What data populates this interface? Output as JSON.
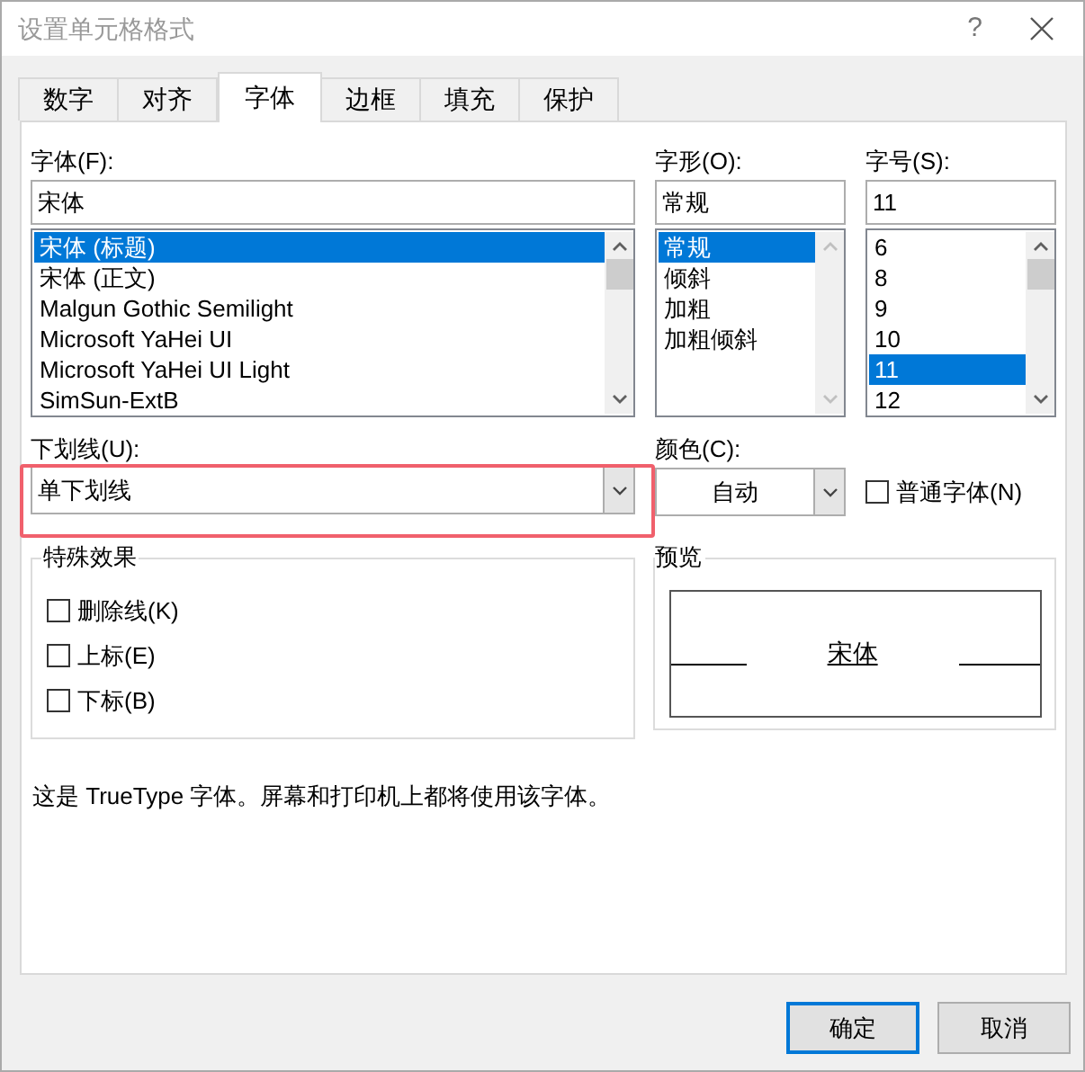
{
  "window": {
    "title": "设置单元格格式",
    "help": "?"
  },
  "tabs": [
    {
      "label": "数字",
      "selected": false
    },
    {
      "label": "对齐",
      "selected": false
    },
    {
      "label": "字体",
      "selected": true
    },
    {
      "label": "边框",
      "selected": false
    },
    {
      "label": "填充",
      "selected": false
    },
    {
      "label": "保护",
      "selected": false
    }
  ],
  "font": {
    "label": "字体(F):",
    "value": "宋体",
    "items": [
      {
        "text": "宋体 (标题)",
        "selected": true
      },
      {
        "text": "宋体 (正文)",
        "selected": false
      },
      {
        "text": "Malgun Gothic Semilight",
        "selected": false
      },
      {
        "text": "Microsoft YaHei UI",
        "selected": false
      },
      {
        "text": "Microsoft YaHei UI Light",
        "selected": false
      },
      {
        "text": "SimSun-ExtB",
        "selected": false
      }
    ]
  },
  "style": {
    "label": "字形(O):",
    "value": "常规",
    "items": [
      {
        "text": "常规",
        "selected": true
      },
      {
        "text": "倾斜",
        "selected": false
      },
      {
        "text": "加粗",
        "selected": false
      },
      {
        "text": "加粗倾斜",
        "selected": false
      }
    ]
  },
  "size": {
    "label": "字号(S):",
    "value": "11",
    "items": [
      {
        "text": "6",
        "selected": false
      },
      {
        "text": "8",
        "selected": false
      },
      {
        "text": "9",
        "selected": false
      },
      {
        "text": "10",
        "selected": false
      },
      {
        "text": "11",
        "selected": true
      },
      {
        "text": "12",
        "selected": false
      }
    ]
  },
  "underline": {
    "label": "下划线(U):",
    "value": "单下划线",
    "highlighted": true
  },
  "color": {
    "label": "颜色(C):",
    "value": "自动"
  },
  "normal_font": {
    "label": "普通字体(N)",
    "checked": false
  },
  "effects": {
    "title": "特殊效果",
    "items": [
      {
        "label": "删除线(K)",
        "checked": false
      },
      {
        "label": "上标(E)",
        "checked": false
      },
      {
        "label": "下标(B)",
        "checked": false
      }
    ]
  },
  "preview": {
    "title": "预览",
    "sample": "宋体"
  },
  "note": "这是 TrueType 字体。屏幕和打印机上都将使用该字体。",
  "buttons": [
    {
      "label": "确定",
      "default": true
    },
    {
      "label": "取消",
      "default": false
    }
  ]
}
